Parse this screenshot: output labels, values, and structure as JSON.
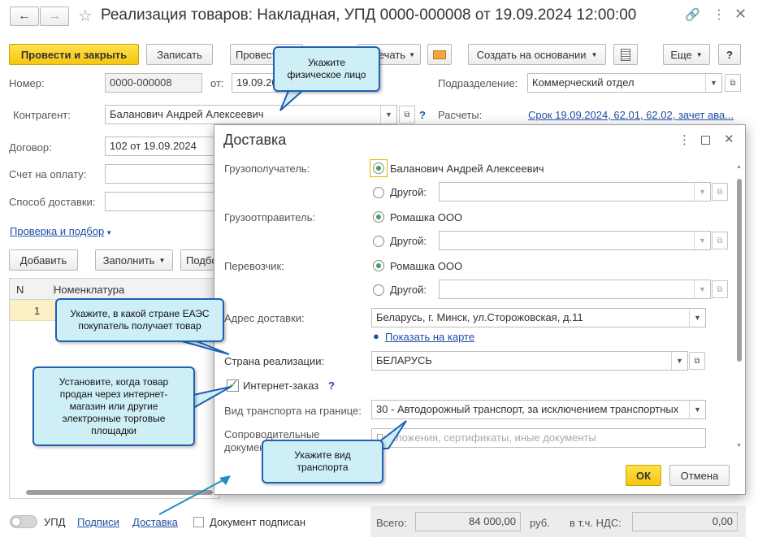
{
  "window": {
    "title": "Реализация товаров: Накладная, УПД 0000-000008 от 19.09.2024 12:00:00",
    "back_icon": "arrow-left-icon",
    "forward_icon": "arrow-right-icon",
    "star_icon": "star-icon",
    "link_icon": "link-icon",
    "menu_icon": "more-vertical-icon",
    "close_icon": "close-icon"
  },
  "toolbar": {
    "post_close": "Провести и закрыть",
    "save": "Записать",
    "post": "Провести",
    "print": "Печать",
    "create_based": "Создать на основании",
    "more": "Еще",
    "help": "?"
  },
  "form": {
    "number_label": "Номер:",
    "number_value": "0000-000008",
    "from_label": "от:",
    "date_value": "19.09.2024",
    "division_label": "Подразделение:",
    "division_value": "Коммерческий отдел",
    "counterparty_label": "Контрагент:",
    "counterparty_value": "Баланович Андрей Алексеевич",
    "settlements_label": "Расчеты:",
    "settlements_link": "Срок 19.09.2024, 62.01, 62.02, зачет ава...",
    "contract_label": "Договор:",
    "contract_value": "102 от 19.09.2024",
    "invoice_label": "Счет на оплату:",
    "delivery_method_label": "Способ доставки:",
    "check_link": "Проверка и подбор",
    "add_button": "Добавить",
    "fill_button": "Заполнить",
    "pick_button": "Подбор",
    "table_headers": [
      "N",
      "Номенклатура"
    ],
    "table_rows": [
      {
        "n": "1"
      }
    ]
  },
  "footer": {
    "upd_label": "УПД",
    "signatures_link": "Подписи",
    "delivery_link": "Доставка",
    "signed_label": "Документ подписан",
    "total_label": "Всего:",
    "total_value": "84 000,00",
    "currency": "руб.",
    "vat_label": "в т.ч. НДС:",
    "vat_value": "0,00"
  },
  "dialog": {
    "title": "Доставка",
    "consignee_label": "Грузополучатель:",
    "consignee_value": "Баланович Андрей Алексеевич",
    "other_label": "Другой:",
    "shipper_label": "Грузоотправитель:",
    "shipper_value": "Ромашка ООО",
    "carrier_label": "Перевозчик:",
    "carrier_value": "Ромашка ООО",
    "address_label": "Адрес доставки:",
    "address_value": "Беларусь, г. Минск, ул.Сторожовская, д.11",
    "map_link": "Показать на карте",
    "country_label": "Страна реализации:",
    "country_value": "БЕЛАРУСЬ",
    "internet_order_label": "Интернет-заказ",
    "internet_order_checked": true,
    "transport_label": "Вид транспорта на границе:",
    "transport_value": "30 - Автодорожный транспорт, за исключением транспортных",
    "docs_label_1": "Сопроводительные",
    "docs_label_2": "документы",
    "docs_placeholder": "Приложения, сертификаты, иные документы",
    "ok": "ОК",
    "cancel": "Отмена"
  },
  "callouts": {
    "physical_person": "Укажите физическое лицо",
    "country_hint": "Укажите, в какой стране ЕАЭС покупатель получает товар",
    "internet_hint": "Установите, когда товар продан через интернет-магазин или другие электронные торговые площадки",
    "transport_hint": "Укажите вид транспорта"
  },
  "colors": {
    "accent_yellow": "#f6c60f",
    "link_blue": "#1f4fa5",
    "callout_fill": "#cfeff7",
    "callout_border": "#1f5fb4",
    "radio_green": "#3aa35c"
  }
}
